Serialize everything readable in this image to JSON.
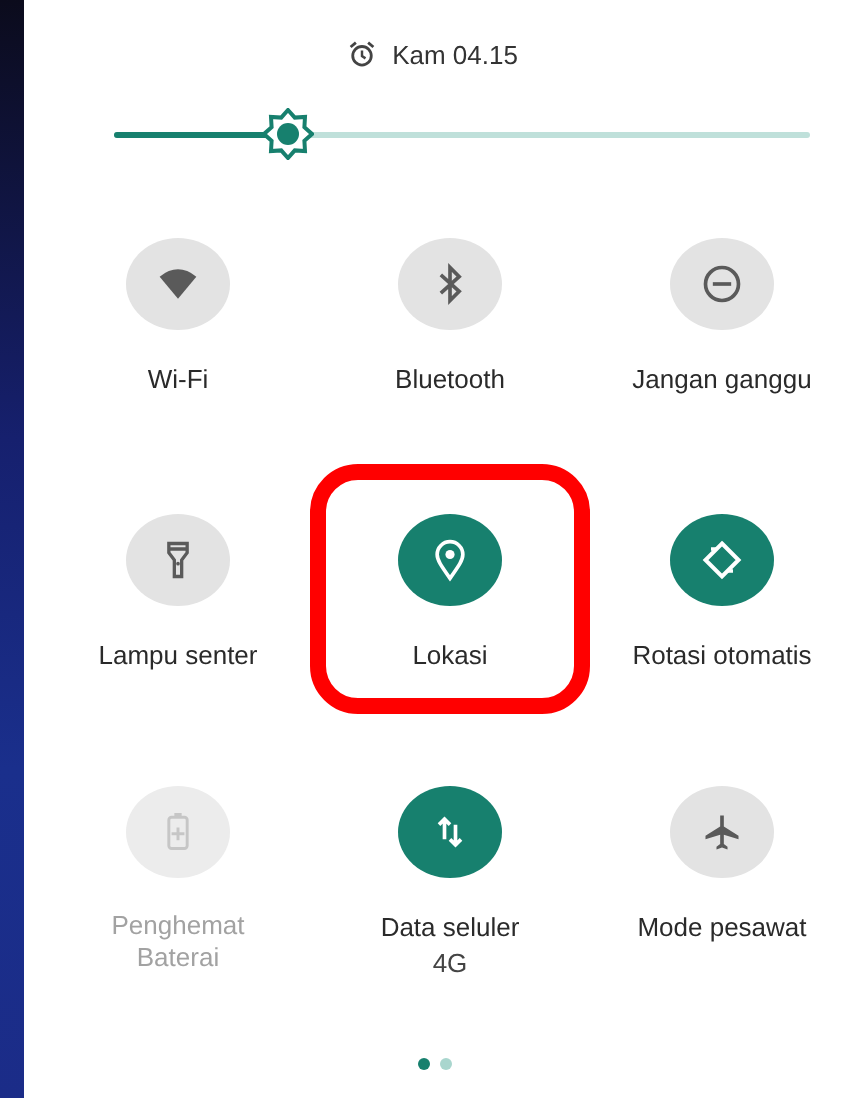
{
  "status": {
    "alarm_time": "Kam 04.15"
  },
  "brightness": {
    "level": 0.25
  },
  "tiles": [
    {
      "label": "Wi-Fi",
      "on": false,
      "disabled": false,
      "highlighted": false
    },
    {
      "label": "Bluetooth",
      "on": false,
      "disabled": false,
      "highlighted": false
    },
    {
      "label": "Jangan ganggu",
      "on": false,
      "disabled": false,
      "highlighted": false
    },
    {
      "label": "Lampu senter",
      "on": false,
      "disabled": false,
      "highlighted": false
    },
    {
      "label": "Lokasi",
      "on": true,
      "disabled": false,
      "highlighted": true
    },
    {
      "label": "Rotasi otomatis",
      "on": true,
      "disabled": false,
      "highlighted": false
    },
    {
      "label": "Penghemat Baterai",
      "on": false,
      "disabled": true,
      "highlighted": false
    },
    {
      "label": "Data seluler",
      "subtitle": "4G",
      "on": true,
      "disabled": false,
      "highlighted": false
    },
    {
      "label": "Mode pesawat",
      "on": false,
      "disabled": false,
      "highlighted": false
    }
  ],
  "pages": [
    {
      "selected": true
    },
    {
      "selected": false
    }
  ]
}
